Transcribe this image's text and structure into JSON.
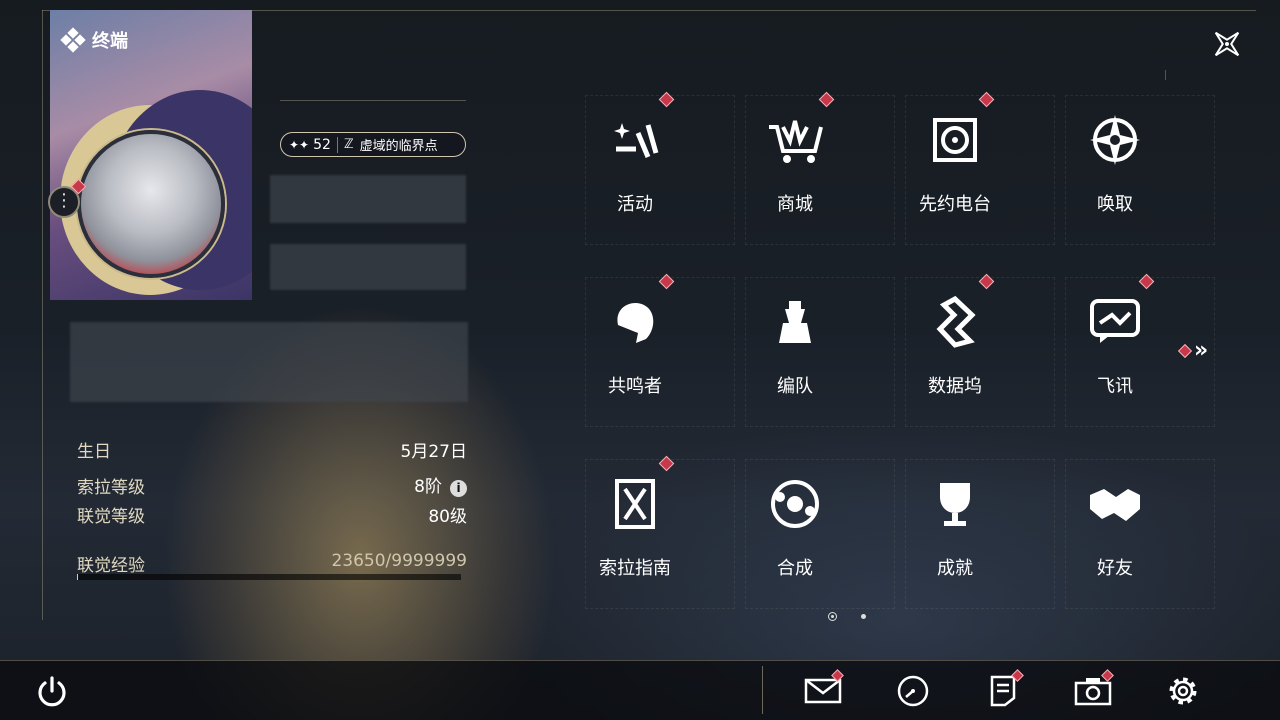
{
  "header": {
    "title": "终端"
  },
  "profile": {
    "level_badge": "52",
    "region_label": "虚域的临界点"
  },
  "stats": [
    {
      "label": "生日",
      "value": "5月27日"
    },
    {
      "label": "索拉等级",
      "value": "8阶"
    },
    {
      "label": "联觉等级",
      "value": "80级"
    },
    {
      "label": "联觉经验",
      "value": "23650/9999999"
    }
  ],
  "exp_progress": 0.0024,
  "menu": [
    {
      "label": "活动",
      "icon": "activity-icon",
      "dot": true
    },
    {
      "label": "商城",
      "icon": "shop-cart-icon",
      "dot": true
    },
    {
      "label": "先约电台",
      "icon": "radio-icon",
      "dot": true
    },
    {
      "label": "唤取",
      "icon": "summon-icon",
      "dot": false
    },
    {
      "label": "共鸣者",
      "icon": "resonator-icon",
      "dot": true
    },
    {
      "label": "编队",
      "icon": "team-icon",
      "dot": false
    },
    {
      "label": "数据坞",
      "icon": "data-bank-icon",
      "dot": true
    },
    {
      "label": "飞讯",
      "icon": "message-icon",
      "dot": true
    },
    {
      "label": "索拉指南",
      "icon": "guide-icon",
      "dot": true
    },
    {
      "label": "合成",
      "icon": "synthesis-icon",
      "dot": false
    },
    {
      "label": "成就",
      "icon": "trophy-icon",
      "dot": false
    },
    {
      "label": "好友",
      "icon": "handshake-icon",
      "dot": false
    }
  ],
  "bottom_bar": {
    "icons": [
      "power-icon",
      "mail-icon",
      "clock-icon",
      "notice-icon",
      "camera-icon",
      "gear-icon"
    ]
  },
  "colors": {
    "accent_red": "#c7384a",
    "gold": "#cfc6ad"
  }
}
